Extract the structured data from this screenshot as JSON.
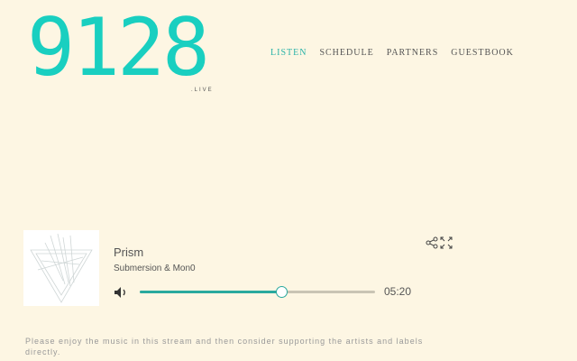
{
  "logo": {
    "text": "9128",
    "sub": ".LIVE"
  },
  "nav": [
    {
      "label": "LISTEN",
      "active": true
    },
    {
      "label": "SCHEDULE"
    },
    {
      "label": "PARTNERS"
    },
    {
      "label": "GUESTBOOK"
    }
  ],
  "player": {
    "title": "Prism",
    "artist": "Submersion & Mon0",
    "time": "05:20",
    "progress": 0.6
  },
  "info": {
    "line1": "Please enjoy the music in this stream and then consider supporting the artists and labels directly."
  },
  "colors": {
    "accent": "#19cfc0",
    "background": "#fdf6e3"
  }
}
